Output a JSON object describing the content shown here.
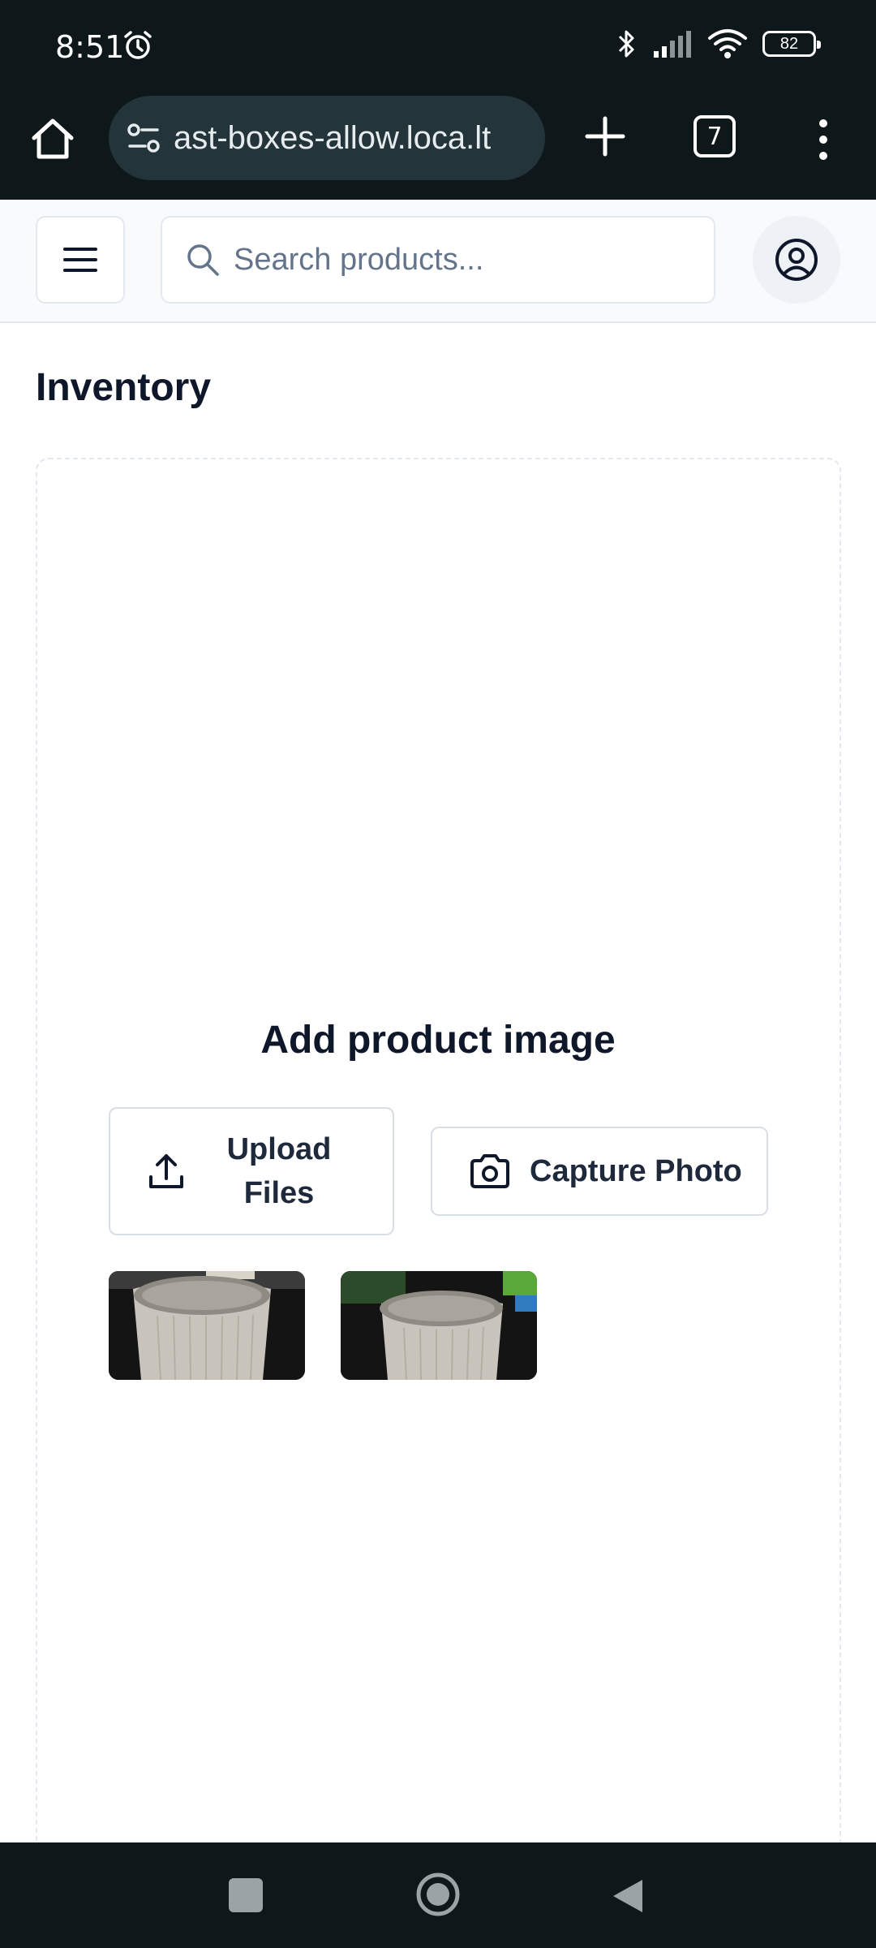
{
  "status_bar": {
    "time": "8:51",
    "battery": "82",
    "icons": [
      "alarm-icon",
      "bluetooth-icon",
      "signal-icon",
      "wifi-icon",
      "battery-icon"
    ]
  },
  "browser": {
    "url": "ast-boxes-allow.loca.lt",
    "tab_count": "7"
  },
  "header": {
    "search_placeholder": "Search products..."
  },
  "page": {
    "title": "Inventory"
  },
  "dropzone": {
    "heading": "Add product image",
    "upload_label": "Upload Files",
    "capture_label": "Capture Photo"
  },
  "thumbnails": [
    "product-photo-cup-1",
    "product-photo-cup-2"
  ],
  "colors": {
    "system_bar": "#0e1719",
    "url_pill": "#23343a",
    "header_bg": "#f8fafc",
    "border": "#e2e8f0",
    "text": "#0f172a",
    "placeholder": "#64748b"
  }
}
